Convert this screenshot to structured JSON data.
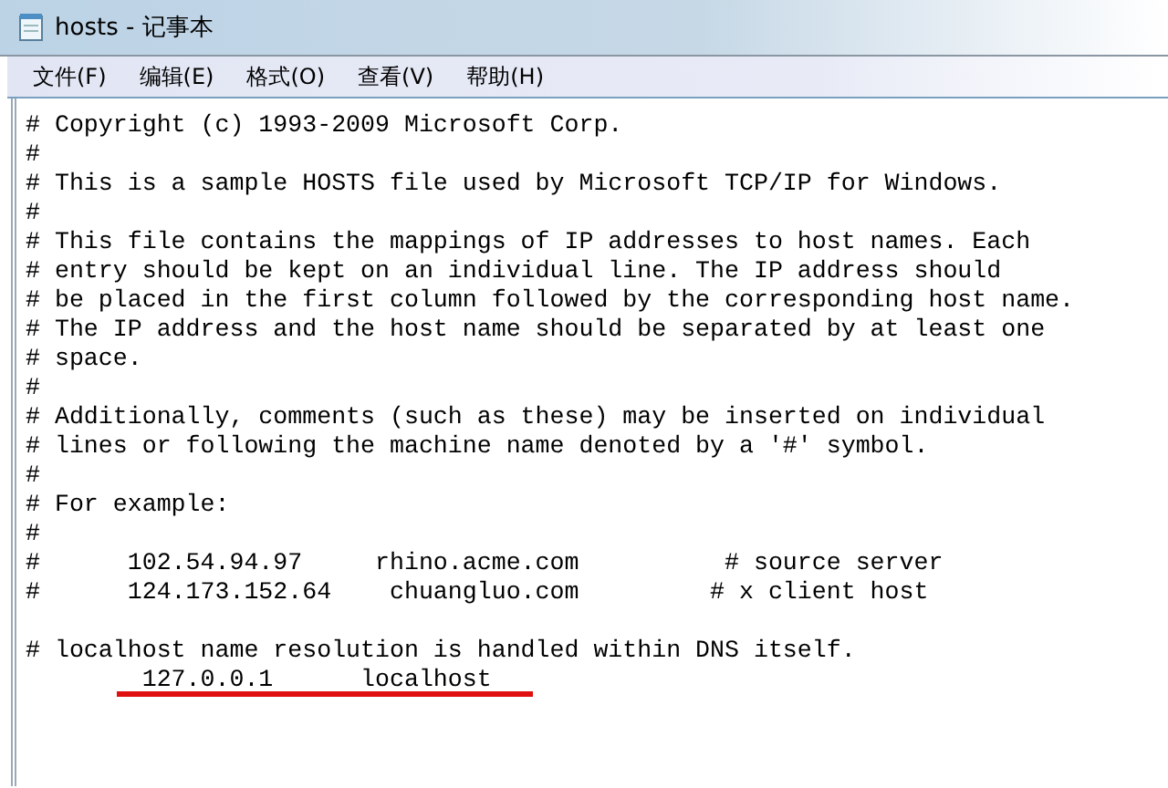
{
  "window": {
    "title": "hosts - 记事本"
  },
  "menu": [
    "文件(F)",
    "编辑(E)",
    "格式(O)",
    "查看(V)",
    "帮助(H)"
  ],
  "lines": [
    {
      "kind": "text",
      "text": "# Copyright (c) 1993-2009 Microsoft Corp."
    },
    {
      "kind": "text",
      "text": "#"
    },
    {
      "kind": "text",
      "text": "# This is a sample HOSTS file used by Microsoft TCP/IP for Windows."
    },
    {
      "kind": "text",
      "text": "#"
    },
    {
      "kind": "text",
      "text": "# This file contains the mappings of IP addresses to host names. Each"
    },
    {
      "kind": "text",
      "text": "# entry should be kept on an individual line. The IP address should"
    },
    {
      "kind": "text",
      "text": "# be placed in the first column followed by the corresponding host name."
    },
    {
      "kind": "text",
      "text": "# The IP address and the host name should be separated by at least one"
    },
    {
      "kind": "text",
      "text": "# space."
    },
    {
      "kind": "text",
      "text": "#"
    },
    {
      "kind": "text",
      "text": "# Additionally, comments (such as these) may be inserted on individual"
    },
    {
      "kind": "text",
      "text": "# lines or following the machine name denoted by a '#' symbol."
    },
    {
      "kind": "text",
      "text": "#"
    },
    {
      "kind": "text",
      "text": "# For example:"
    },
    {
      "kind": "text",
      "text": "#"
    },
    {
      "kind": "text",
      "text": "#      102.54.94.97     rhino.acme.com          # source server"
    },
    {
      "kind": "text",
      "text": "#      124.173.152.64    chuangluo.com         # x client host"
    },
    {
      "kind": "blank"
    },
    {
      "kind": "text",
      "text": "# localhost name resolution is handled within DNS itself."
    },
    {
      "kind": "underlined",
      "text": "        127.0.0.1      localhost"
    }
  ]
}
